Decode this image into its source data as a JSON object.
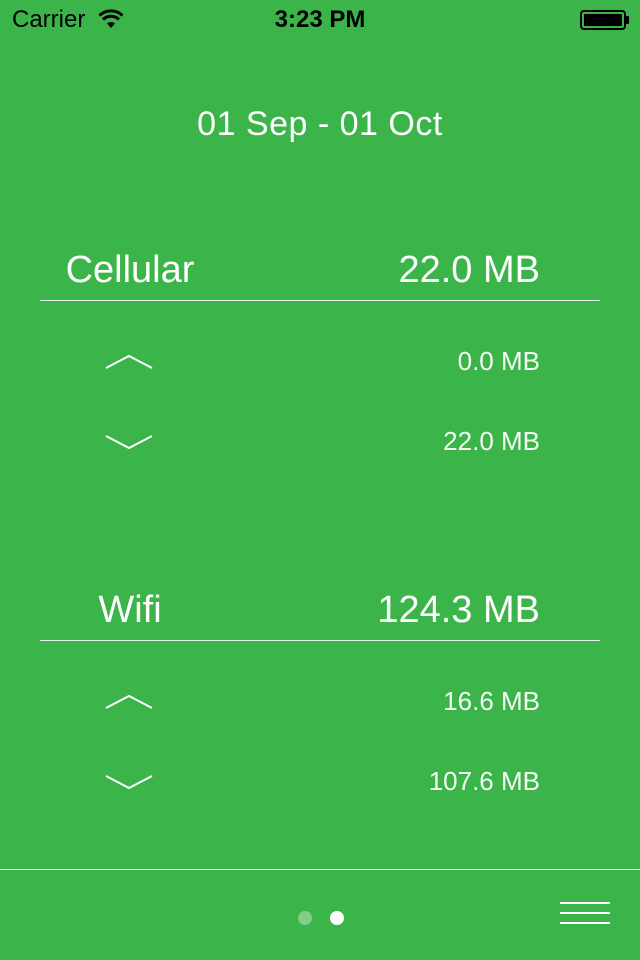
{
  "status_bar": {
    "carrier": "Carrier",
    "time": "3:23 PM",
    "wifi_icon": "wifi-icon",
    "battery_icon": "battery-icon"
  },
  "date_range": "01 Sep - 01 Oct",
  "cellular": {
    "label": "Cellular",
    "total": "22.0 MB",
    "upload": "0.0 MB",
    "download": "22.0 MB"
  },
  "wifi": {
    "label": "Wifi",
    "total": "124.3 MB",
    "upload": "16.6 MB",
    "download": "107.6 MB"
  },
  "pager": {
    "page_count": 2,
    "current_page": 2
  },
  "icons": {
    "upload": "chevron-up-icon",
    "download": "chevron-down-icon",
    "menu": "menu-icon"
  },
  "colors": {
    "background": "#3bb54a",
    "foreground": "#ffffff"
  }
}
